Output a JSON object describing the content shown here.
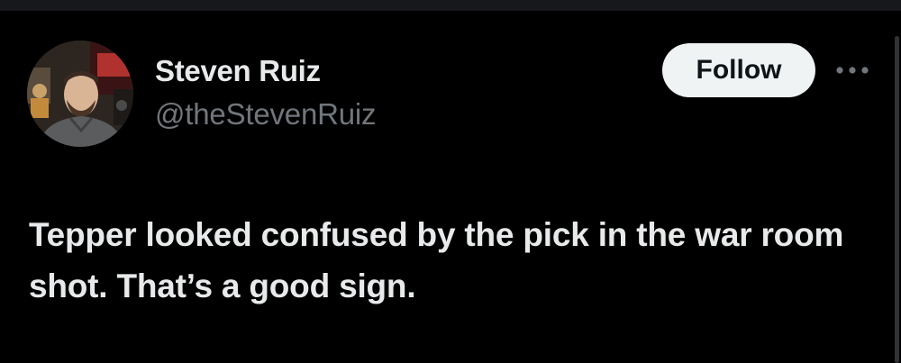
{
  "post": {
    "author": {
      "display_name": "Steven Ruiz",
      "handle": "@theStevenRuiz",
      "avatar_icon": "profile-photo"
    },
    "follow_label": "Follow",
    "more_icon": "more-horizontal-icon",
    "text": "Tepper looked confused by the pick in the war room shot. That’s a good sign."
  },
  "colors": {
    "background": "#000000",
    "primary_text": "#e7e9ea",
    "secondary_text": "#71767b",
    "follow_button_bg": "#eff3f4",
    "follow_button_text": "#0f1419"
  }
}
